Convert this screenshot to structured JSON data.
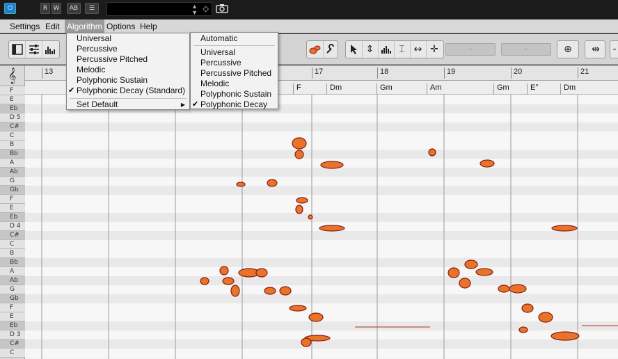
{
  "topbar": {
    "record_read": "R",
    "record_write": "W",
    "ab_label": "AB",
    "list_label": "☰",
    "preset_value": "",
    "camera": "camera-icon"
  },
  "menubar": {
    "items": [
      "Settings",
      "Edit",
      "Algorithm",
      "Options",
      "Help"
    ]
  },
  "toolbar": {
    "field1": "-",
    "field2": "-"
  },
  "algorithm_menu": {
    "items": [
      {
        "label": "Universal",
        "checked": false
      },
      {
        "label": "Percussive",
        "checked": false
      },
      {
        "label": "Percussive Pitched",
        "checked": false
      },
      {
        "label": "Melodic",
        "checked": false
      },
      {
        "label": "Polyphonic Sustain",
        "checked": false
      },
      {
        "label": "Polyphonic Decay (Standard)",
        "checked": true
      }
    ],
    "set_default": "Set Default"
  },
  "submenu": {
    "automatic": "Automatic",
    "items": [
      {
        "label": "Universal",
        "checked": false
      },
      {
        "label": "Percussive",
        "checked": false
      },
      {
        "label": "Percussive Pitched",
        "checked": false
      },
      {
        "label": "Melodic",
        "checked": false
      },
      {
        "label": "Polyphonic Sustain",
        "checked": false
      },
      {
        "label": "Polyphonic Decay",
        "checked": true
      }
    ]
  },
  "ruler": {
    "bars": [
      "13",
      "17",
      "18",
      "19",
      "20",
      "21"
    ]
  },
  "chords": [
    "F",
    "Dm",
    "Gm",
    "Am",
    "Gm",
    "E°",
    "Dm"
  ],
  "piano": {
    "notes": [
      "F",
      "E",
      "Eb",
      "D 5",
      "C#",
      "C",
      "B",
      "Bb",
      "A",
      "Ab",
      "G",
      "Gb",
      "F",
      "E",
      "Eb",
      "D 4",
      "C#",
      "C",
      "B",
      "Bb",
      "A",
      "Ab",
      "G",
      "Gb",
      "F",
      "E",
      "Eb",
      "D 3",
      "C#",
      "C"
    ]
  },
  "colors": {
    "blob_fill": "#e8742a",
    "blob_edge": "#8b1a10",
    "menu_highlight": "#9a9a9a",
    "power_blue": "#1f7fd0"
  }
}
